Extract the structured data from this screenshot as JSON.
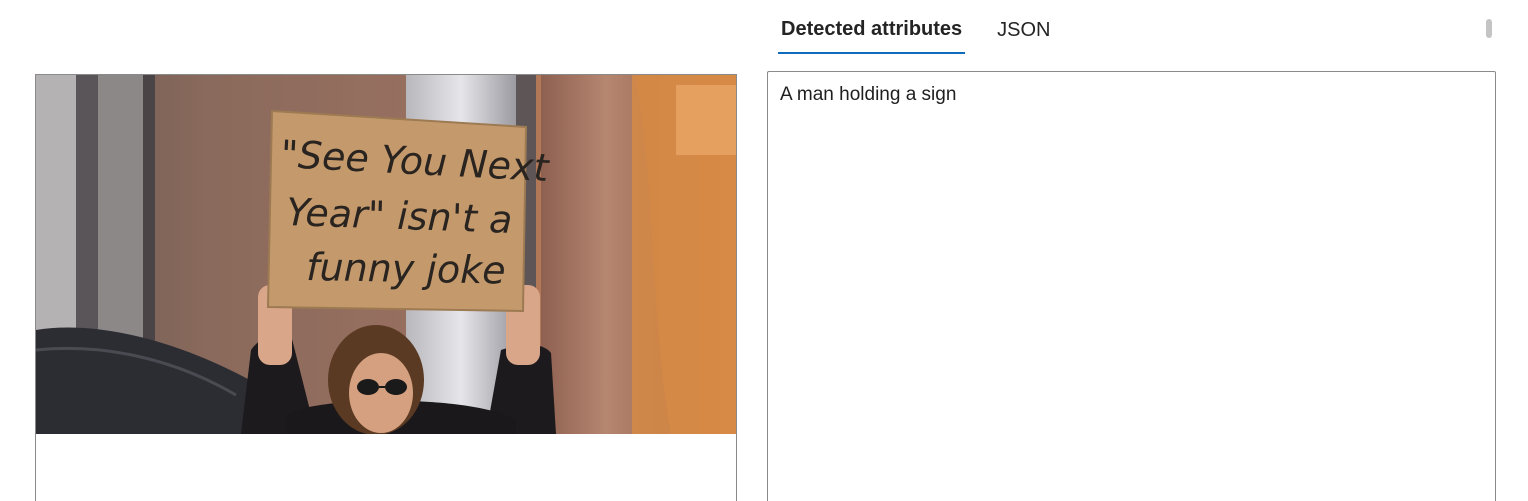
{
  "tabs": [
    {
      "label": "Detected attributes",
      "selected": true
    },
    {
      "label": "JSON",
      "selected": false
    }
  ],
  "image": {
    "sign_text": [
      "\"See You Next",
      "Year\" isn't a",
      "funny joke"
    ]
  },
  "result": {
    "caption": "A man holding a sign"
  },
  "colors": {
    "tab_underline": "#0f6cbd",
    "border": "#8a8a8a",
    "sign": "#c49a6c"
  }
}
